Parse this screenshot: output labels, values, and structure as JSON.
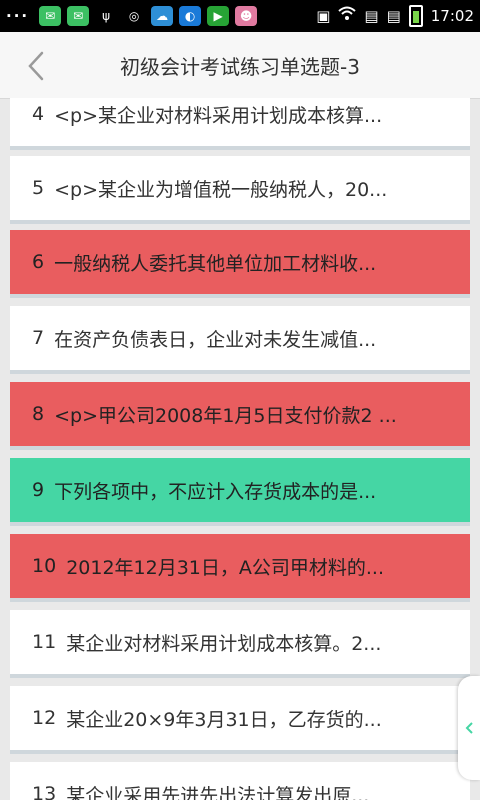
{
  "status_bar": {
    "dots": "···",
    "time": "17:02",
    "icons": [
      "message-icon",
      "message-icon",
      "usb-icon",
      "screenshot-icon",
      "weather-icon",
      "app-icon",
      "app-icon",
      "app-icon",
      "sim-icon",
      "wifi-icon",
      "sim1-icon",
      "sim2-icon",
      "battery-icon"
    ]
  },
  "header": {
    "title": "初级会计考试练习单选题-3"
  },
  "questions": [
    {
      "num": "4",
      "text": "<p>某企业对材料采用计划成本核算...",
      "status": "none"
    },
    {
      "num": "5",
      "text": "<p>某企业为增值税一般纳税人，20...",
      "status": "none"
    },
    {
      "num": "6",
      "text": "一般纳税人委托其他单位加工材料收...",
      "status": "wrong"
    },
    {
      "num": "7",
      "text": "在资产负债表日，企业对未发生减值...",
      "status": "none"
    },
    {
      "num": "8",
      "text": "<p>甲公司2008年1月5日支付价款2 ...",
      "status": "wrong"
    },
    {
      "num": "9",
      "text": "下列各项中，不应计入存货成本的是...",
      "status": "right"
    },
    {
      "num": "10",
      "text": "2012年12月31日，A公司甲材料的...",
      "status": "wrong"
    },
    {
      "num": "11",
      "text": "某企业对材料采用计划成本核算。2...",
      "status": "none"
    },
    {
      "num": "12",
      "text": "某企业20×9年3月31日，乙存货的...",
      "status": "none"
    },
    {
      "num": "13",
      "text": "某企业采用先进先出法计算发出原...",
      "status": "none"
    }
  ],
  "colors": {
    "wrong": "#e95d5f",
    "right": "#45d6a4",
    "item_bg": "#ffffff",
    "separator": "#cfd7dc"
  }
}
